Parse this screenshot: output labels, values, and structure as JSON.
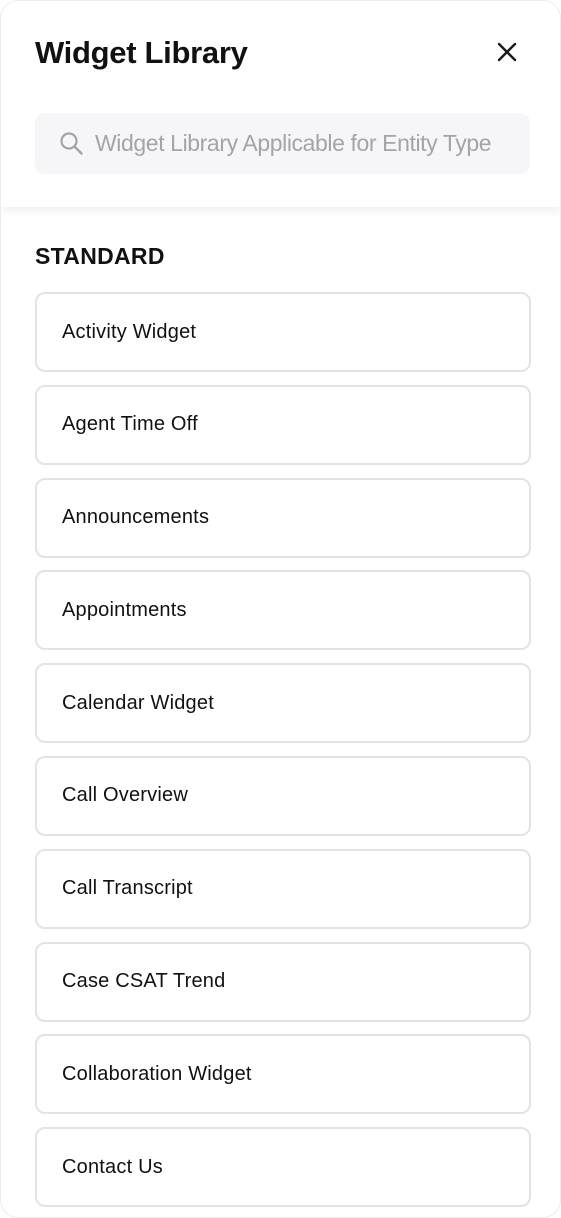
{
  "header": {
    "title": "Widget Library",
    "close_icon": "close-icon"
  },
  "search": {
    "placeholder": "Widget Library Applicable for Entity Type",
    "value": "",
    "icon": "search-icon"
  },
  "section": {
    "title": "STANDARD"
  },
  "widgets": [
    {
      "label": "Activity Widget"
    },
    {
      "label": "Agent Time Off"
    },
    {
      "label": "Announcements"
    },
    {
      "label": "Appointments"
    },
    {
      "label": "Calendar Widget"
    },
    {
      "label": "Call Overview"
    },
    {
      "label": "Call Transcript"
    },
    {
      "label": "Case CSAT Trend"
    },
    {
      "label": "Collaboration Widget"
    },
    {
      "label": "Contact Us"
    }
  ],
  "colors": {
    "text": "#111111",
    "border": "#e3e3e6",
    "search_bg": "#f6f6f8",
    "placeholder": "#a3a3aa"
  }
}
